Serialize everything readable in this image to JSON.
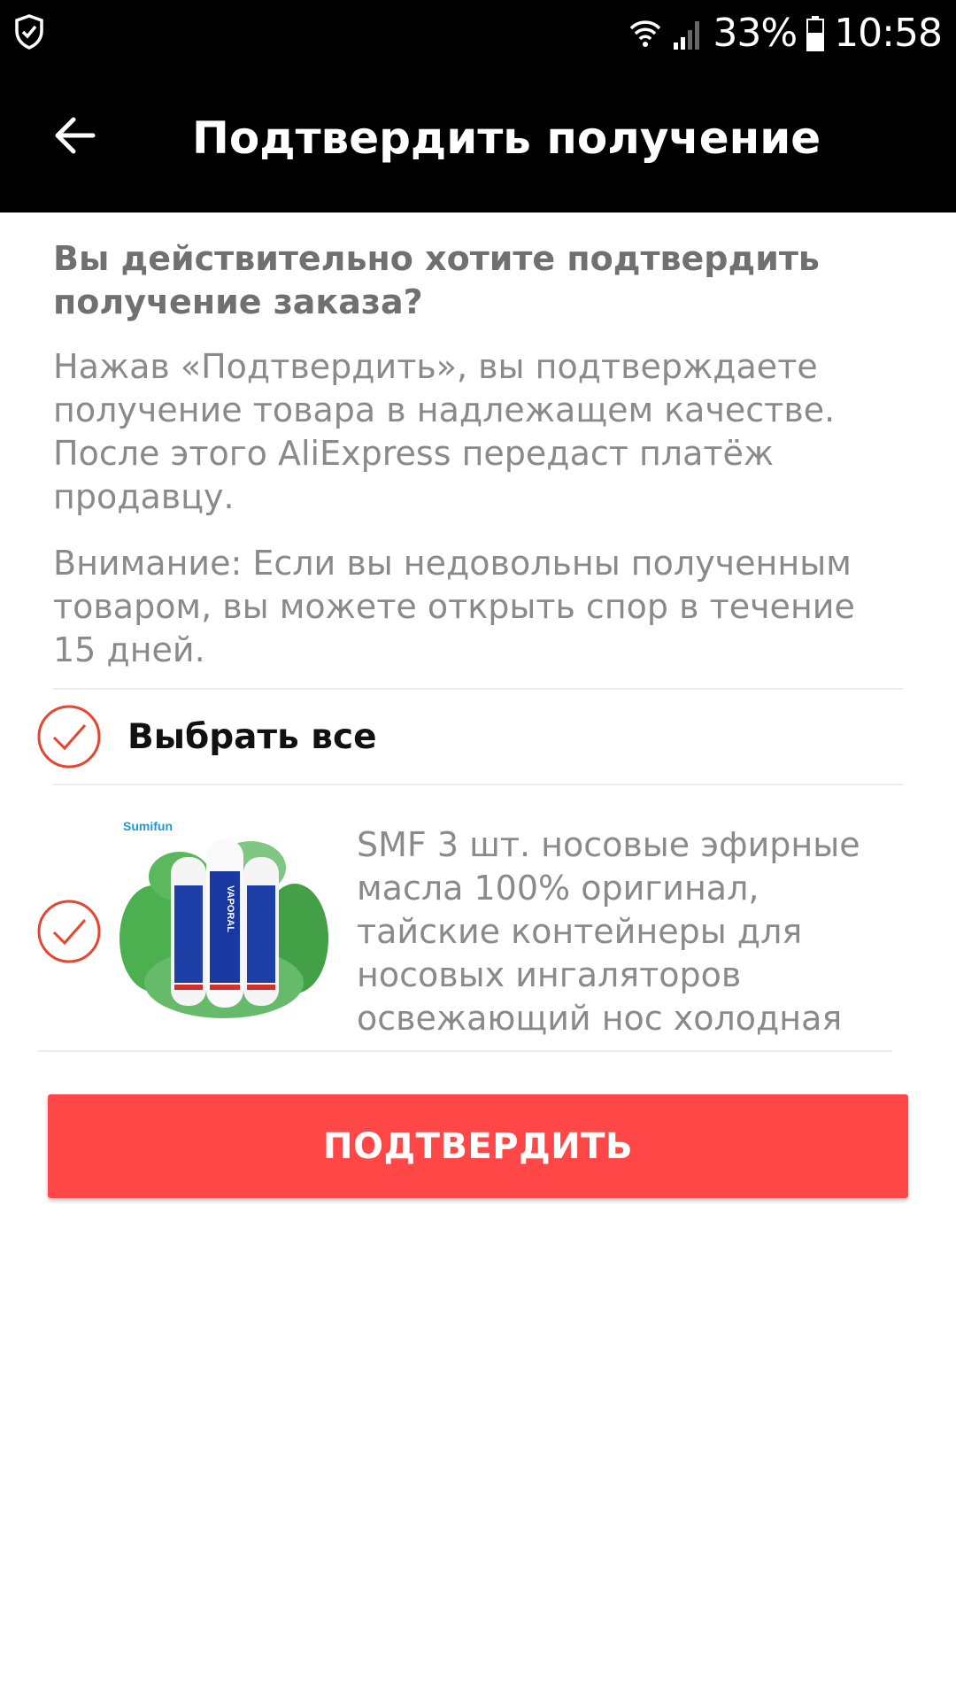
{
  "status_bar": {
    "battery": "33%",
    "time": "10:58",
    "icons": [
      "shield-icon",
      "wifi-icon",
      "signal-icon",
      "battery-icon"
    ]
  },
  "app_bar": {
    "title": "Подтвердить получение",
    "back_icon": "arrow-left-icon"
  },
  "dialog": {
    "heading": "Вы действительно хотите подтвердить получение заказа?",
    "description": "Нажав «Подтвердить», вы подтверждаете получение товара в надлежащем качестве. После этого AliExpress передаст платёж продавцу.",
    "warning": "Внимание: Если вы недовольны полученным товаром, вы можете открыть спор в течение 15 дней."
  },
  "select_all": {
    "label": "Выбрать все",
    "checked": true
  },
  "product": {
    "title": "SMF 3 шт. носовые эфирные масла 100% оригинал, тайские контейнеры для носовых ингаляторов освежающий нос холодная",
    "image_brand": "Sumifun",
    "image_label": "VAPORAL",
    "checked": true
  },
  "confirm_button": {
    "label": "ПОДТВЕРДИТЬ"
  },
  "colors": {
    "accent": "#ff4747",
    "check_red": "#e6452f",
    "header_bg": "#000000",
    "text_gray": "#8a8a8a"
  }
}
